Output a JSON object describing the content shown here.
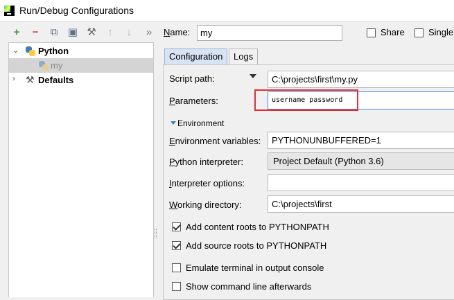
{
  "window": {
    "title": "Run/Debug Configurations"
  },
  "toolbar": {
    "buttons": [
      {
        "icon": "plus-icon",
        "glyph": "+",
        "color": "#3a9c3a"
      },
      {
        "icon": "minus-icon",
        "glyph": "−",
        "color": "#d23c3c"
      },
      {
        "icon": "copy-icon",
        "glyph": "⧉",
        "color": "#5a6f8a"
      },
      {
        "icon": "save-icon",
        "glyph": "▣",
        "color": "#5a6f8a"
      },
      {
        "icon": "wrench-icon",
        "glyph": "⚒",
        "color": "#6b6b6b"
      },
      {
        "icon": "arrow-up-icon",
        "glyph": "↑",
        "color": "#b0b0b0"
      },
      {
        "icon": "arrow-down-icon",
        "glyph": "↓",
        "color": "#b0b0b0"
      },
      {
        "icon": "more-icon",
        "glyph": "»",
        "color": "#777777"
      }
    ]
  },
  "tree": {
    "python_label": "Python",
    "my_label": "my",
    "defaults_label": "Defaults"
  },
  "form": {
    "name_label": "Name:",
    "name_value": "my",
    "share_label": "Share",
    "single_label": "Single"
  },
  "tabs": [
    {
      "label": "Configuration",
      "active": true
    },
    {
      "label": "Logs",
      "active": false
    }
  ],
  "config": {
    "script_path_label": "Script path:",
    "script_path_value": "C:\\projects\\first\\my.py",
    "parameters_label": "Parameters:",
    "parameters_value": "username password",
    "environment_label": "Environment",
    "env_vars_label": "Environment variables:",
    "env_vars_value": "PYTHONUNBUFFERED=1",
    "interpreter_label": "Python interpreter:",
    "interpreter_value": "Project Default (Python 3.6)",
    "interp_options_label": "Interpreter options:",
    "interp_options_value": "",
    "workdir_label": "Working directory:",
    "workdir_value": "C:\\projects\\first",
    "checkboxes": [
      {
        "label": "Add content roots to PYTHONPATH",
        "checked": true
      },
      {
        "label": "Add source roots to PYTHONPATH",
        "checked": true
      },
      {
        "label": "Emulate terminal in output console",
        "checked": false
      },
      {
        "label": "Show command line afterwards",
        "checked": false
      }
    ]
  },
  "colors": {
    "highlight": "#e03030",
    "tab_active": "#d6e4f5"
  }
}
